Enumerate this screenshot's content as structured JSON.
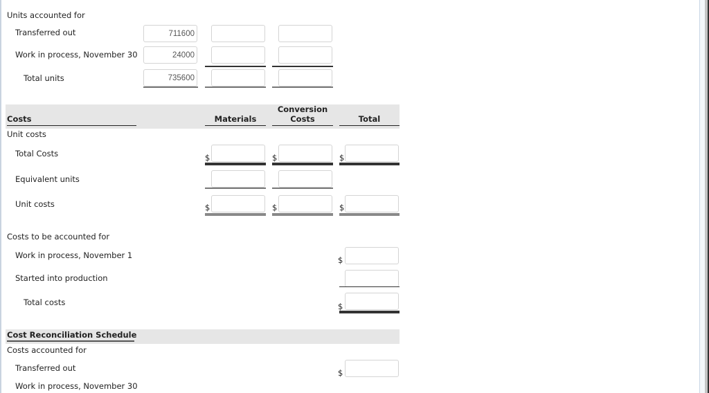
{
  "units_section": {
    "title": "Units accounted for",
    "rows": [
      {
        "label": "Transferred out",
        "physical": "711600",
        "materials": "",
        "conversion": ""
      },
      {
        "label": "Work in process, November 30",
        "physical": "24000",
        "materials": "",
        "conversion": ""
      },
      {
        "label": "Total units",
        "physical": "735600",
        "materials": "",
        "conversion": ""
      }
    ]
  },
  "costs_section": {
    "title": "Costs",
    "columns": {
      "materials": "Materials",
      "conversion_line1": "Conversion",
      "conversion_line2": "Costs",
      "total": "Total"
    },
    "subtitle": "Unit costs",
    "rows": {
      "total_costs": {
        "label": "Total Costs",
        "materials": "",
        "conversion": "",
        "total": ""
      },
      "equivalent_units": {
        "label": "Equivalent units",
        "materials": "",
        "conversion": ""
      },
      "unit_costs": {
        "label": "Unit costs",
        "materials": "",
        "conversion": "",
        "total": ""
      }
    },
    "currency_symbol": "$"
  },
  "costs_to_account": {
    "title": "Costs to be accounted for",
    "rows": {
      "wip_nov1": {
        "label": "Work in process, November 1",
        "total": ""
      },
      "started": {
        "label": "Started into production",
        "total": ""
      },
      "total_costs": {
        "label": "Total costs",
        "total": ""
      }
    }
  },
  "reconciliation": {
    "title": "Cost Reconciliation Schedule",
    "subtitle": "Costs accounted for",
    "rows": {
      "transferred_out": {
        "label": "Transferred out",
        "total": ""
      },
      "wip_nov30": {
        "label": "Work in process, November 30"
      }
    }
  }
}
